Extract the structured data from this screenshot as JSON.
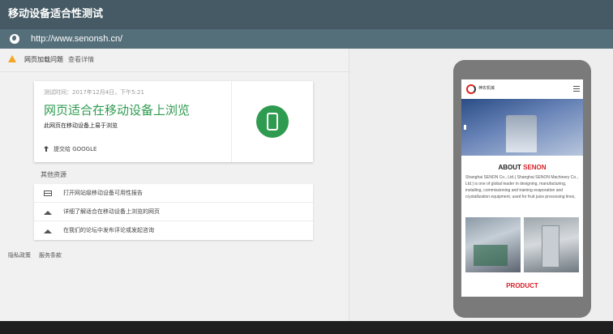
{
  "window": {
    "title": "移动设备适合性测试"
  },
  "address_bar": {
    "url": "http://www.senonsh.cn/"
  },
  "issues": {
    "label": "网页加载问题",
    "link": "查看详情"
  },
  "result_card": {
    "test_time": "测试时间：2017年12月4日，下午5:21",
    "headline": "网页适合在移动设备上浏览",
    "subtext": "此网页在移动设备上易于浏览",
    "submit_label": "提交给 GOOGLE"
  },
  "other_resources": {
    "title": "其他资源",
    "items": [
      {
        "icon": "report-icon",
        "label": "打开网站级移动设备可用性报告"
      },
      {
        "icon": "learn-icon",
        "label": "详细了解适合在移动设备上浏览的网页"
      },
      {
        "icon": "forum-icon",
        "label": "在我们的论坛中发布评论或发起咨询"
      }
    ]
  },
  "footer": {
    "privacy": "隐私政策",
    "terms": "服务条款"
  },
  "preview": {
    "logo_text": "神农机械",
    "about_prefix": "ABOUT ",
    "about_brand": "SENON",
    "about_body": "Shanghai SENON Co., Ltd.( Shanghai SENON Machinery Co., Ltd.) is one of global leader in designing, manufacturing, installing, commissioning and training evaporation and crystallization equipment, used for fruit juice processing lines,",
    "product_heading": "PRODUCT"
  },
  "colors": {
    "title_bar": "#455a64",
    "url_bar": "#546e7a",
    "success_green": "#2e9b50",
    "warning_orange": "#f6a623",
    "brand_red": "#d81f26"
  }
}
